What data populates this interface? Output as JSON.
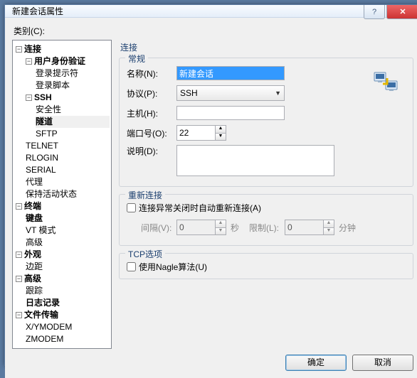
{
  "window": {
    "title": "新建会话属性"
  },
  "category_label": "类别(C):",
  "tree": {
    "connection": "连接",
    "auth": "用户身份验证",
    "login_prompt": "登录提示符",
    "login_script": "登录脚本",
    "ssh": "SSH",
    "security": "安全性",
    "tunnel": "隧道",
    "sftp": "SFTP",
    "telnet": "TELNET",
    "rlogin": "RLOGIN",
    "serial": "SERIAL",
    "proxy": "代理",
    "keepalive": "保持活动状态",
    "terminal": "终端",
    "keyboard": "键盘",
    "vtmode": "VT 模式",
    "advanced_t": "高级",
    "appearance": "外观",
    "margin": "边距",
    "advanced": "高级",
    "trace": "跟踪",
    "logging": "日志记录",
    "filetransfer": "文件传输",
    "xymodem": "X/YMODEM",
    "zmodem": "ZMODEM"
  },
  "right_title": "连接",
  "general": {
    "legend": "常规",
    "name_lbl": "名称(N):",
    "name_val": "新建会话",
    "protocol_lbl": "协议(P):",
    "protocol_val": "SSH",
    "host_lbl": "主机(H):",
    "host_val": "",
    "port_lbl": "端口号(O):",
    "port_val": "22",
    "desc_lbl": "说明(D):"
  },
  "reconnect": {
    "legend": "重新连接",
    "chk": "连接异常关闭时自动重新连接(A)",
    "interval_lbl": "间隔(V):",
    "interval_val": "0",
    "sec": "秒",
    "limit_lbl": "限制(L):",
    "limit_val": "0",
    "min": "分钟"
  },
  "tcp": {
    "legend": "TCP选项",
    "nagle": "使用Nagle算法(U)"
  },
  "buttons": {
    "ok": "确定",
    "cancel": "取消"
  }
}
